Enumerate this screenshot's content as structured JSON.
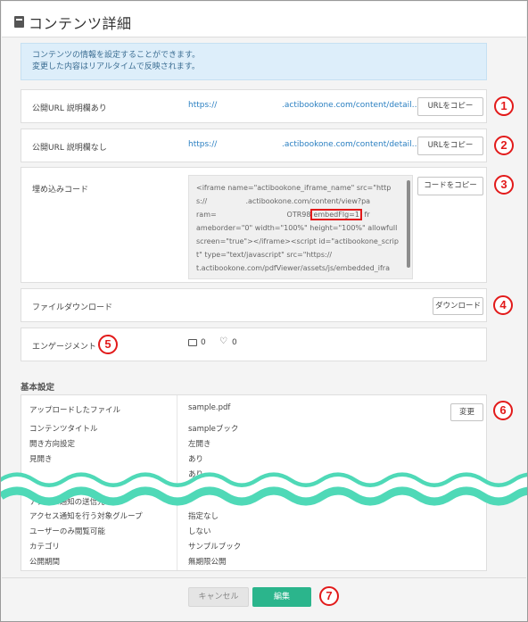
{
  "header": {
    "title": "コンテンツ詳細",
    "icon": "book-icon"
  },
  "info": {
    "line1": "コンテンツの情報を設定することができます。",
    "line2": "変更した内容はリアルタイムで反映されます。"
  },
  "public_url_with_desc": {
    "label": "公開URL 説明欄あり",
    "url_start": "https://",
    "url_end": ".actibookone.com/content/detail…",
    "copy_button": "URLをコピー",
    "badge": "1"
  },
  "public_url_no_desc": {
    "label": "公開URL 説明欄なし",
    "url_start": "https://",
    "url_end": ".actibookone.com/content/detail…",
    "copy_button": "URLをコピー",
    "badge": "2"
  },
  "embed": {
    "label": "埋め込みコード",
    "copy_button": "コードをコピー",
    "badge": "3",
    "code_lines": [
      "<iframe name=\"actibookone_iframe_name\" src=\"http",
      "s://                 .actibookone.com/content/view?pa",
      "ram=                               OTR98",
      "ameborder=\"0\" width=\"100%\" height=\"100%\" allowfull",
      "screen=\"true\"></iframe><script id=\"actibookone_scrip",
      "t\" type=\"text/javascript\" src=\"https://",
      "t.actibookone.com/pdfViewer/assets/js/embedded_ifra"
    ],
    "highlight": "embedFlg=1",
    "line3_tail": " fr"
  },
  "download": {
    "label": "ファイルダウンロード",
    "button": "ダウンロード",
    "badge": "4"
  },
  "engagement": {
    "label": "エンゲージメント",
    "badge": "5",
    "comments": "0",
    "likes": "0",
    "comment_icon": "comment-icon",
    "like_icon": "heart-icon"
  },
  "basic_settings": {
    "title": "基本設定",
    "change_button": "変更",
    "badge": "6",
    "rows": [
      {
        "label": "アップロードしたファイル",
        "value": "sample.pdf"
      },
      {
        "label": "コンテンツタイトル",
        "value": "sampleブック"
      },
      {
        "label": "開き方向設定",
        "value": "左開き"
      },
      {
        "label": "見開き",
        "value": "あり"
      },
      {
        "label": "",
        "value": "あり"
      },
      {
        "label": "アクセス通知の送信先",
        "value": ""
      },
      {
        "label": "アクセス通知を行う対象グループ",
        "value": "指定なし"
      },
      {
        "label": "ユーザーのみ閲覧可能",
        "value": "しない"
      },
      {
        "label": "カテゴリ",
        "value": "サンプルブック"
      },
      {
        "label": "公開期間",
        "value": "無期限公開"
      }
    ]
  },
  "footer": {
    "cancel": "キャンセル",
    "edit": "編集",
    "badge": "7"
  },
  "colors": {
    "accent": "#2bb58c",
    "badge_red": "#e21a1a",
    "link": "#2a7fc1",
    "info_bg": "#ddeefa",
    "wave": "#4fd9b7"
  }
}
